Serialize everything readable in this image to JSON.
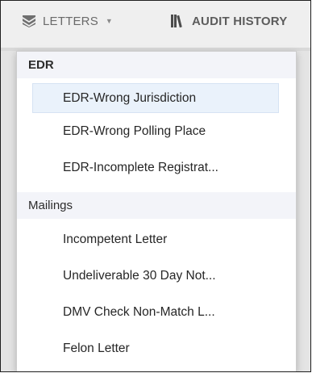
{
  "toolbar": {
    "letters_label": "LETTERS",
    "letters_icon": "envelope-stack-icon",
    "audit_label": "AUDIT HISTORY",
    "audit_icon": "books-icon",
    "caret_icon": "caret-down-icon"
  },
  "dropdown": {
    "sections": [
      {
        "title": "EDR",
        "items": [
          {
            "label": "EDR-Wrong Jurisdiction"
          },
          {
            "label": "EDR-Wrong Polling Place"
          },
          {
            "label": "EDR-Incomplete Registrat..."
          }
        ]
      },
      {
        "title": "Mailings",
        "items": [
          {
            "label": "Incompetent Letter"
          },
          {
            "label": "Undeliverable 30 Day Not..."
          },
          {
            "label": "DMV Check Non-Match L..."
          },
          {
            "label": "Felon Letter"
          }
        ]
      }
    ],
    "active_item": "EDR-Wrong Jurisdiction"
  },
  "colors": {
    "toolbar_bg": "#efefef",
    "section_bg": "#f3f4f9",
    "active_item_bg": "#eaf2fb",
    "text": "#262626"
  }
}
